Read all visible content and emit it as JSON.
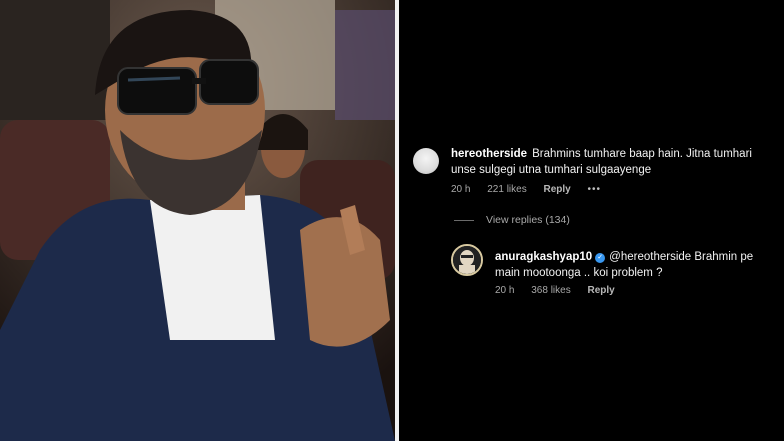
{
  "comment": {
    "username": "hereotherside",
    "text": "Brahmins tumhare baap hain. Jitna tumhari unse sulgegi utna tumhari sulgaayenge",
    "time": "20 h",
    "likes": "221 likes",
    "reply_label": "Reply",
    "more": "•••",
    "view_replies": "View replies (134)"
  },
  "reply": {
    "username": "anuragkashyap10",
    "text": "@hereotherside Brahmin pe main mootoonga .. koi problem ?",
    "time": "20 h",
    "likes": "368 likes",
    "reply_label": "Reply"
  },
  "colors": {
    "panel_bg": "#000000",
    "verified": "#3897f0",
    "meta_text": "#a9a9a9"
  }
}
